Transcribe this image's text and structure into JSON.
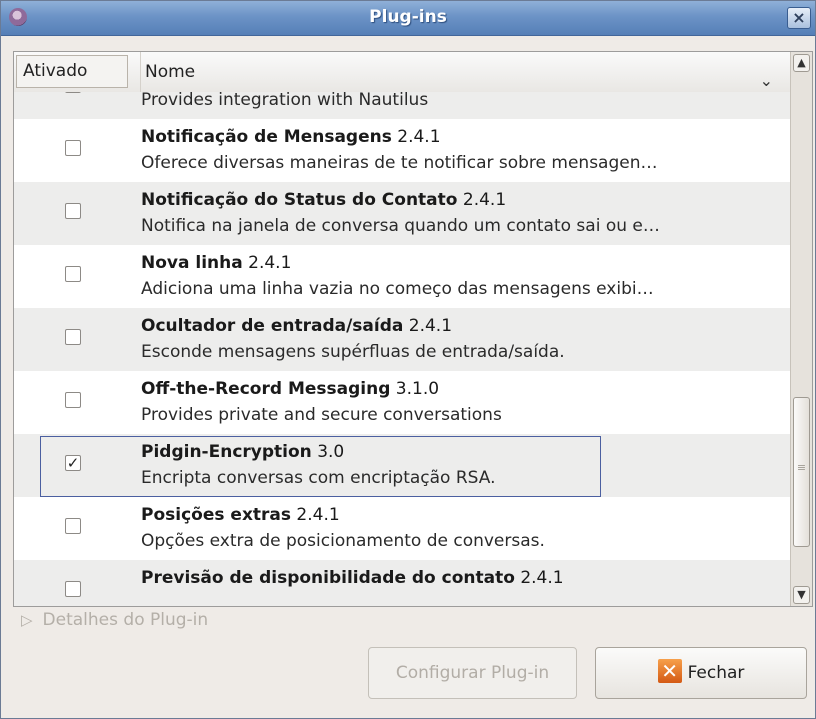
{
  "window": {
    "title": "Plug-ins",
    "close_symbol": "×"
  },
  "columns": {
    "enabled": "Ativado",
    "name": "Nome"
  },
  "rows": [
    {
      "name": "",
      "version": "",
      "description": "Provides integration with Nautilus",
      "checked": false
    },
    {
      "name": "Notificação de Mensagens",
      "version": "2.4.1",
      "description": "Oferece diversas maneiras de te notificar sobre mensagen…",
      "checked": false
    },
    {
      "name": "Notificação do Status do Contato",
      "version": "2.4.1",
      "description": "Notifica na janela de conversa quando um contato sai ou e…",
      "checked": false
    },
    {
      "name": "Nova linha",
      "version": "2.4.1",
      "description": "Adiciona uma linha vazia no começo das mensagens exibi…",
      "checked": false
    },
    {
      "name": "Ocultador de entrada/saída",
      "version": "2.4.1",
      "description": "Esconde mensagens supérfluas de entrada/saída.",
      "checked": false
    },
    {
      "name": "Off-the-Record Messaging",
      "version": "3.1.0",
      "description": "Provides private and secure conversations",
      "checked": false
    },
    {
      "name": "Pidgin-Encryption",
      "version": "3.0",
      "description": "Encripta conversas com encriptação RSA.",
      "checked": true
    },
    {
      "name": "Posições extras",
      "version": "2.4.1",
      "description": "Opções extra de posicionamento de conversas.",
      "checked": false
    },
    {
      "name": "Previsão de disponibilidade do contato",
      "version": "2.4.1",
      "description": "",
      "checked": false
    }
  ],
  "details_label": "Detalhes do Plug-in",
  "buttons": {
    "configure": "Configurar Plug-in",
    "close": "Fechar"
  },
  "check_mark": "✓",
  "icons": {
    "app": "pidgin-icon",
    "close": "close-icon",
    "expander": "triangle-right-icon",
    "chevron": "chevron-down-icon"
  }
}
